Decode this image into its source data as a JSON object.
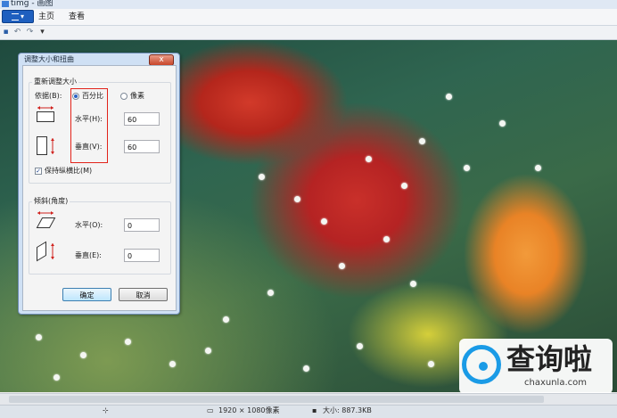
{
  "window": {
    "title": "timg - 画图"
  },
  "ribbon": {
    "file_label": "▾",
    "tabs": [
      "主页",
      "查看"
    ]
  },
  "dialog": {
    "title": "调整大小和扭曲",
    "close": "x",
    "resize_group": "重新调整大小",
    "by_label": "依据(B):",
    "percent": "百分比",
    "pixels": "像素",
    "horizontal_label": "水平(H):",
    "horizontal_value": "60",
    "vertical_label": "垂直(V):",
    "vertical_value": "60",
    "keep_ratio": "保持纵横比(M)",
    "skew_group": "倾斜(角度)",
    "skew_h_label": "水平(O):",
    "skew_h_value": "0",
    "skew_v_label": "垂直(E):",
    "skew_v_value": "0",
    "ok": "确定",
    "cancel": "取消"
  },
  "statusbar": {
    "dimensions": "1920 × 1080像素",
    "size": "大小: 887.3KB"
  },
  "watermark": {
    "text": "查询啦",
    "sub": "chaxunla.com"
  },
  "colors": {
    "accent": "#1e5fbf",
    "highlight_box": "#e2231a",
    "watermark_blue": "#1a9be6"
  }
}
